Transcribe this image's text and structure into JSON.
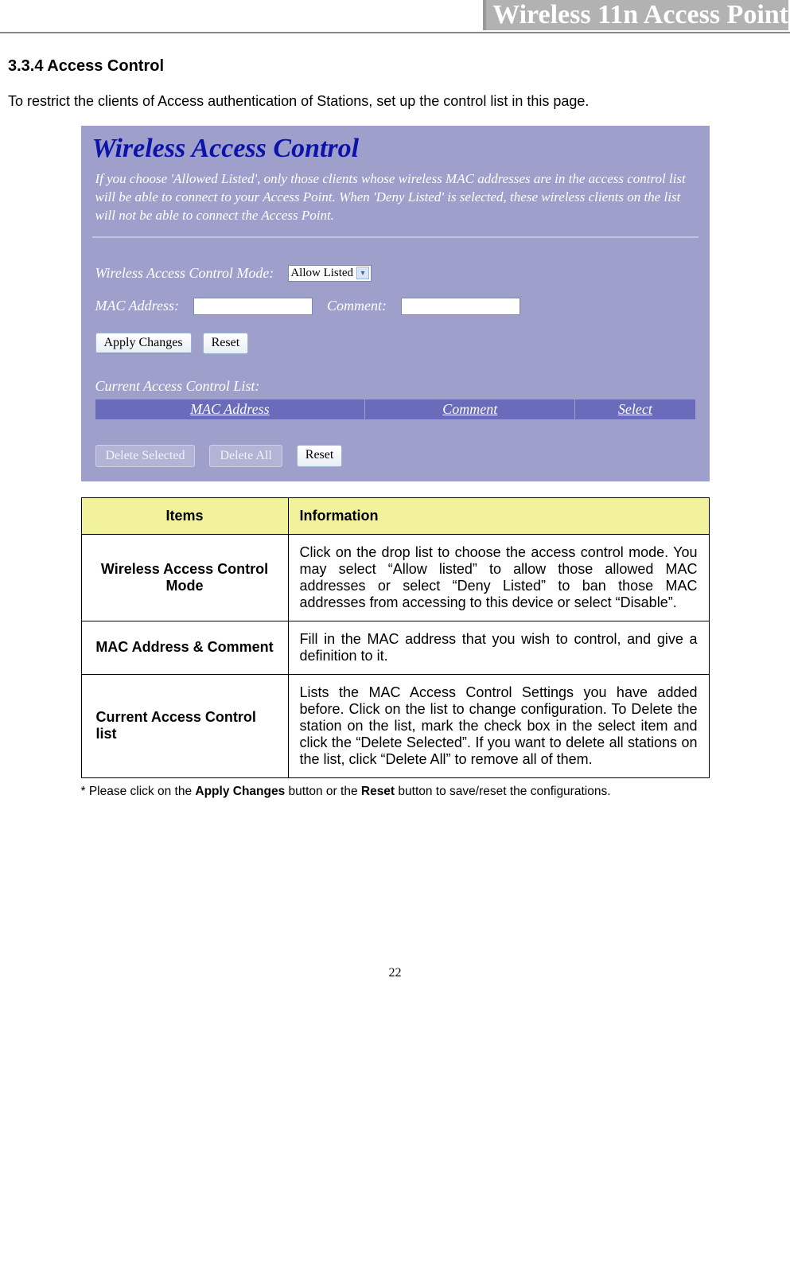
{
  "header": {
    "title": "Wireless 11n Access Point"
  },
  "section": {
    "heading": "3.3.4   Access Control",
    "intro": "To restrict the clients of Access authentication of Stations, set up the control list in this page."
  },
  "router": {
    "title": "Wireless Access Control",
    "description": "If you choose 'Allowed Listed', only those clients whose wireless MAC addresses are in the access control list will be able to connect to your Access Point. When 'Deny Listed' is selected, these wireless clients on the list will not be able to connect the Access Point.",
    "mode_label": "Wireless Access Control Mode:",
    "mode_value": "Allow Listed",
    "mac_label": "MAC Address:",
    "comment_label": "Comment:",
    "apply_changes": "Apply Changes",
    "reset": "Reset",
    "current_list_label": "Current Access Control List:",
    "table_headers": {
      "mac": "MAC Address",
      "comment": "Comment",
      "select": "Select"
    },
    "delete_selected": "Delete Selected",
    "delete_all": "Delete All",
    "reset2": "Reset"
  },
  "info_table": {
    "headers": {
      "items": "Items",
      "information": "Information"
    },
    "rows": [
      {
        "item": "Wireless Access Control Mode",
        "info": "Click on the drop list to choose the access control mode. You may select “Allow listed” to allow those allowed MAC addresses or select “Deny Listed” to ban those MAC addresses from accessing to this device or select “Disable”."
      },
      {
        "item": "MAC Address & Comment",
        "info": "Fill in the MAC address that you wish to control, and give a definition to it."
      },
      {
        "item": "Current Access Control list",
        "info": "Lists the MAC Access Control Settings you have added before. Click on the list to change configuration. To Delete the station on the list, mark the check box in the select item and click the “Delete Selected”. If you want to delete all stations on the list, click “Delete All” to remove all of them."
      }
    ]
  },
  "footnote": {
    "prefix": "* Please click on the ",
    "bold1": "Apply Changes",
    "mid": " button or the ",
    "bold2": "Reset",
    "suffix": " button to save/reset the configurations."
  },
  "page_number": "22"
}
